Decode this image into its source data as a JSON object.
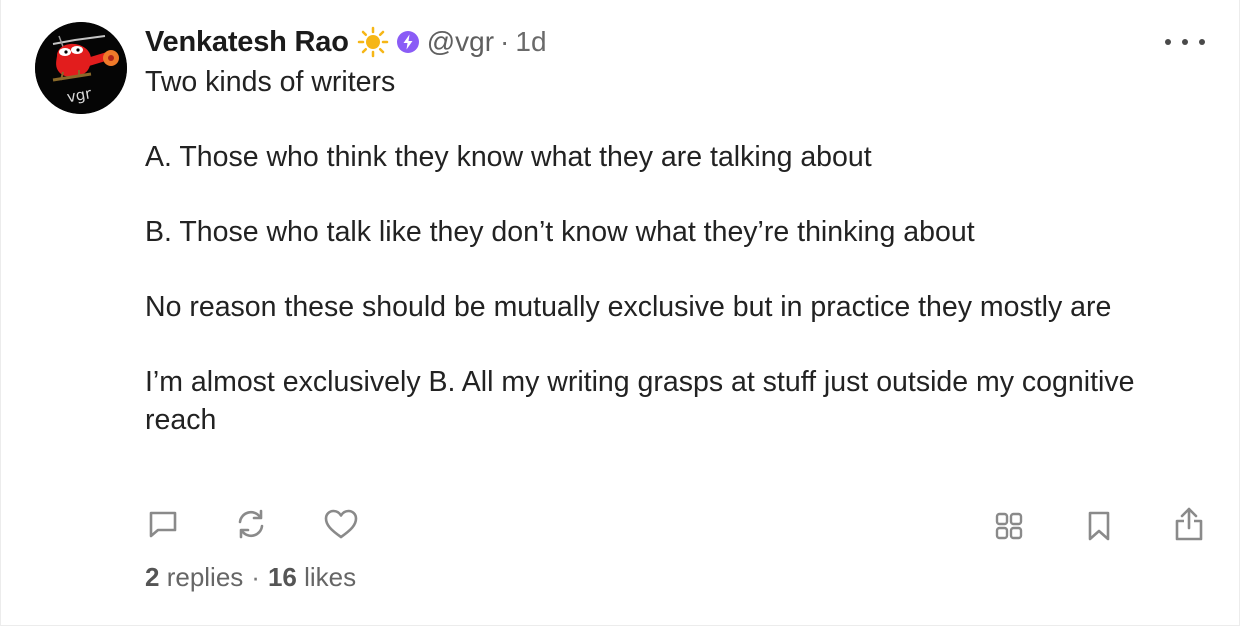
{
  "post": {
    "author_name": "Venkatesh Rao",
    "author_handle": "@vgr",
    "separator": "·",
    "age": "1d",
    "avatar_text": "vgr",
    "badges": [
      "sun-icon",
      "verified-icon"
    ],
    "paragraphs": [
      "Two kinds of writers",
      "A. Those who think they know what they are talking about",
      "B. Those who talk like they don’t know what they’re thinking about",
      "No reason these should be mutually exclusive but in practice they mostly are",
      "I’m almost exclusively B. All my writing grasps at stuff just outside my cognitive reach"
    ],
    "stats": {
      "replies_count": "2",
      "replies_label": "replies",
      "dot": "·",
      "likes_count": "16",
      "likes_label": "likes"
    }
  },
  "actions": {
    "left": [
      "reply-icon",
      "recast-icon",
      "like-icon"
    ],
    "right": [
      "apps-icon",
      "bookmark-icon",
      "share-icon"
    ]
  },
  "colors": {
    "verified": "#8a5cf6",
    "sun": "#f6b616",
    "avatar_bg": "#050505",
    "muted_text": "#666666",
    "icon": "#8a8a8a"
  }
}
